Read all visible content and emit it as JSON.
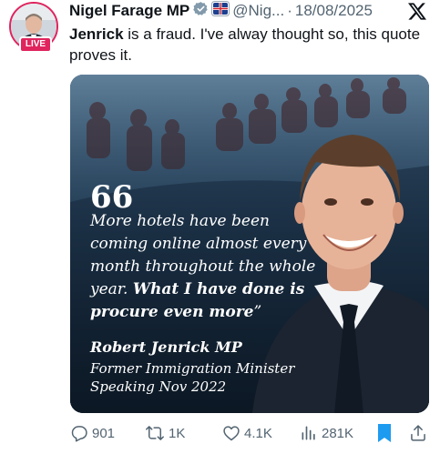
{
  "author": {
    "name": "Nigel Farage MP",
    "handle": "@Nig...",
    "separator": "·",
    "date": "18/08/2025",
    "live_badge": "LIVE",
    "verified_icon": "verified-badge-icon",
    "affiliate_icon": "gb-news-affiliate-icon"
  },
  "tweet": {
    "lead": "Jenrick",
    "text": " is a fraud. I've alway thought so, this quote proves it."
  },
  "media": {
    "quote_mark": "66",
    "quote_plain": "More hotels have been coming online almost every month throughout the whole year. ",
    "quote_bold": "What I have done is procure even more",
    "quote_close": "”",
    "speaker_name": "Robert Jenrick MP",
    "speaker_role": "Former Immigration Minister",
    "speaker_date": "Speaking Nov 2022"
  },
  "actions": {
    "replies": "901",
    "reposts": "1K",
    "likes": "4.1K",
    "views": "281K"
  },
  "colors": {
    "accent": "#1d9bf0",
    "live": "#e0245e",
    "muted": "#536471"
  }
}
